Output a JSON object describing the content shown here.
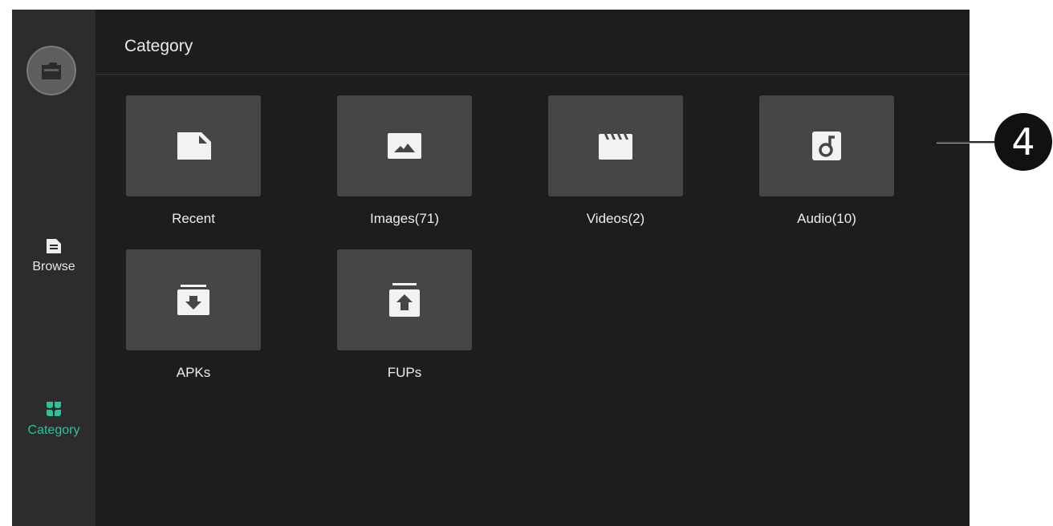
{
  "app": {
    "icon": "folder-icon"
  },
  "sidebar": {
    "items": [
      {
        "label": "Browse",
        "icon": "file-list-icon",
        "active": false
      },
      {
        "label": "Category",
        "icon": "grid-clover-icon",
        "active": true
      }
    ]
  },
  "main": {
    "title": "Category",
    "categories": [
      {
        "label": "Recent",
        "icon": "document-icon"
      },
      {
        "label": "Images(71)",
        "icon": "image-icon"
      },
      {
        "label": "Videos(2)",
        "icon": "clapperboard-icon"
      },
      {
        "label": "Audio(10)",
        "icon": "music-note-icon"
      },
      {
        "label": "APKs",
        "icon": "archive-download-icon"
      },
      {
        "label": "FUPs",
        "icon": "upload-icon"
      }
    ]
  },
  "callout": {
    "number": "4"
  },
  "colors": {
    "accent": "#2fc19b",
    "background": "#1d1d1d",
    "sidebar": "#2c2c2c",
    "tile": "#464646"
  }
}
